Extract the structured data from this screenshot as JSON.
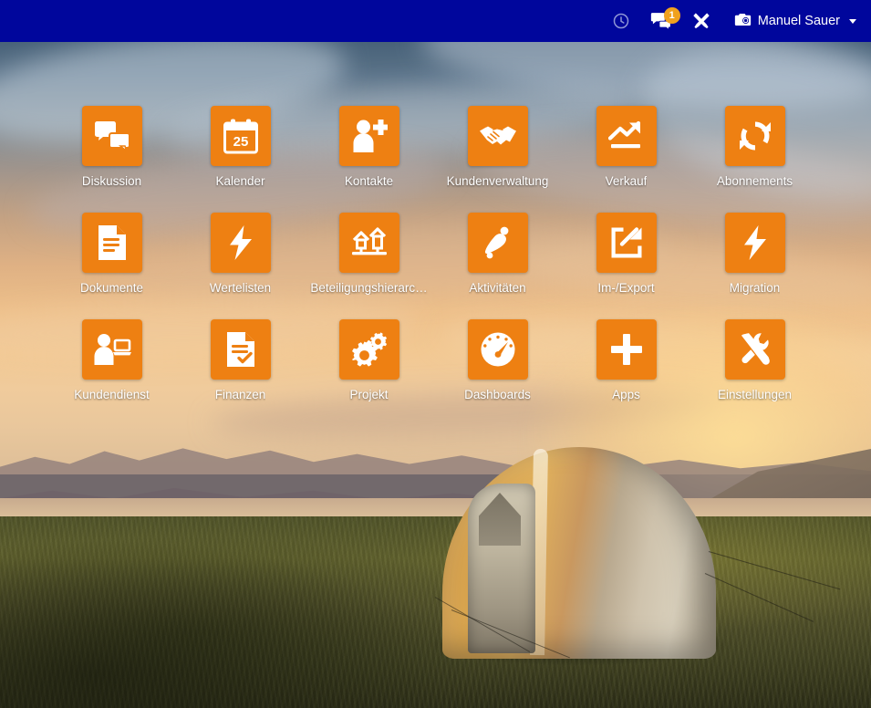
{
  "topbar": {
    "background_color": "#00069c",
    "items": [
      {
        "name": "activity-clock-icon",
        "icon": "clock-icon",
        "label": ""
      },
      {
        "name": "chat-icon",
        "icon": "chat-bubbles-icon",
        "label": "",
        "badge": "1"
      },
      {
        "name": "tools-icon",
        "icon": "tools-icon",
        "label": ""
      }
    ],
    "user": {
      "name": "Manuel Sauer",
      "avatar_icon": "camera-avatar-icon",
      "caret_icon": "chevron-down-icon"
    }
  },
  "accent_color": "#ee8012",
  "badge_color": "#f0a11e",
  "app_grid": {
    "rows": [
      [
        {
          "label": "Diskussion",
          "icon": "chat-bubbles-icon"
        },
        {
          "label": "Kalender",
          "icon": "calendar-25-icon"
        },
        {
          "label": "Kontakte",
          "icon": "person-plus-icon"
        },
        {
          "label": "Kundenverwaltung",
          "icon": "handshake-icon"
        },
        {
          "label": "Verkauf",
          "icon": "trend-up-arrow-icon"
        },
        {
          "label": "Abonnements",
          "icon": "refresh-sync-icon"
        }
      ],
      [
        {
          "label": "Dokumente",
          "icon": "document-lines-icon"
        },
        {
          "label": "Wertelisten",
          "icon": "lightning-bolt-icon"
        },
        {
          "label": "Beteiligungshierarc…",
          "icon": "hierarchy-houses-icon"
        },
        {
          "label": "Aktivitäten",
          "icon": "bell-icon"
        },
        {
          "label": "Im-/Export",
          "icon": "external-link-icon"
        },
        {
          "label": "Migration",
          "icon": "lightning-bolt-icon"
        }
      ],
      [
        {
          "label": "Kundendienst",
          "icon": "person-laptop-icon"
        },
        {
          "label": "Finanzen",
          "icon": "document-check-icon"
        },
        {
          "label": "Projekt",
          "icon": "gears-icon"
        },
        {
          "label": "Dashboards",
          "icon": "gauge-icon"
        },
        {
          "label": "Apps",
          "icon": "plus-icon"
        },
        {
          "label": "Einstellungen",
          "icon": "wrench-screwdriver-icon"
        }
      ]
    ]
  },
  "calendar_day": "25"
}
